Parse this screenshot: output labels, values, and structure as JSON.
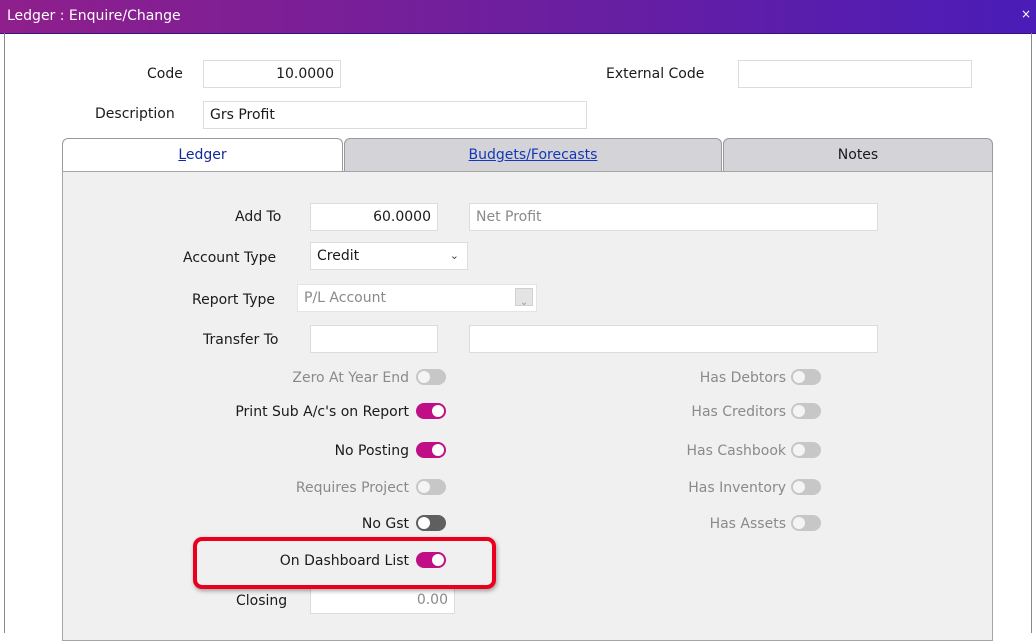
{
  "window": {
    "title": "Ledger : Enquire/Change",
    "close_glyph": "×"
  },
  "header": {
    "code_label": "Code",
    "code_value": "10.0000",
    "external_code_label": "External Code",
    "external_code_value": "",
    "description_label": "Description",
    "description_value": "Grs Profit"
  },
  "tabs": [
    {
      "label_first": "L",
      "label_rest": "edger",
      "active": true
    },
    {
      "label_first": "B",
      "label_rest": "udgets/Forecasts",
      "active": false
    },
    {
      "label": "Notes",
      "active": false
    }
  ],
  "ledger": {
    "add_to_label": "Add To",
    "add_to_code": "60.0000",
    "add_to_name": "Net Profit",
    "account_type_label": "Account Type",
    "account_type_value": "Credit",
    "report_type_label": "Report Type",
    "report_type_value": "P/L Account",
    "transfer_to_label": "Transfer To",
    "transfer_to_code": "",
    "transfer_to_name": "",
    "closing_label": "Closing",
    "closing_value": "0.00",
    "left_toggles": [
      {
        "label": "Zero At Year End",
        "state": "disabled"
      },
      {
        "label": "Print Sub A/c's on Report",
        "state": "on"
      },
      {
        "label": "No Posting",
        "state": "on"
      },
      {
        "label": "Requires Project",
        "state": "disabled"
      },
      {
        "label": "No Gst",
        "state": "off"
      },
      {
        "label": "On Dashboard List",
        "state": "on"
      }
    ],
    "right_toggles": [
      {
        "label": "Has Debtors",
        "state": "disabled"
      },
      {
        "label": "Has Creditors",
        "state": "disabled"
      },
      {
        "label": "Has Cashbook",
        "state": "disabled"
      },
      {
        "label": "Has Inventory",
        "state": "disabled"
      },
      {
        "label": "Has Assets",
        "state": "disabled"
      }
    ]
  },
  "colors": {
    "accent": "#c00f86",
    "title_start": "#8f1f8c",
    "title_end": "#4a1cb8",
    "highlight": "#e8001c"
  }
}
